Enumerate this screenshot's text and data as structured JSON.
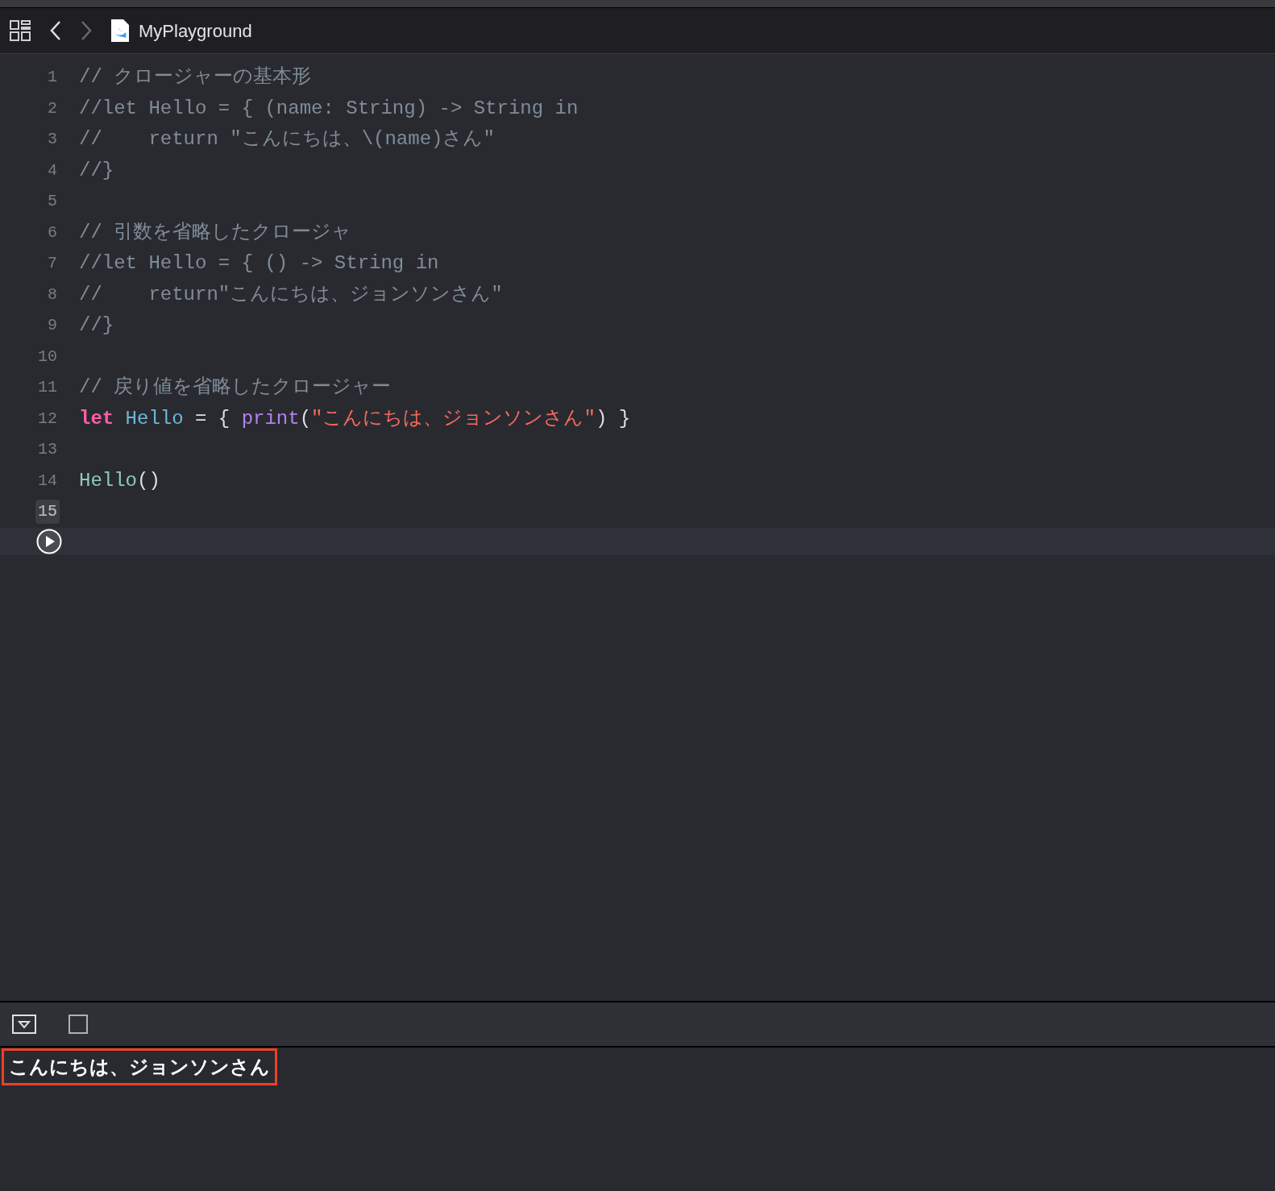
{
  "toolbar": {
    "title": "MyPlayground"
  },
  "editor": {
    "lines": [
      {
        "number": "1",
        "current": false,
        "tokens": [
          {
            "kind": "comment",
            "text": "// クロージャーの基本形"
          }
        ]
      },
      {
        "number": "2",
        "current": false,
        "tokens": [
          {
            "kind": "comment",
            "text": "//let Hello = { (name: String) -> String in"
          }
        ]
      },
      {
        "number": "3",
        "current": false,
        "tokens": [
          {
            "kind": "comment",
            "text": "//    return \"こんにちは、\\(name)さん\""
          }
        ]
      },
      {
        "number": "4",
        "current": false,
        "tokens": [
          {
            "kind": "comment",
            "text": "//}"
          }
        ]
      },
      {
        "number": "5",
        "current": false
      },
      {
        "number": "6",
        "current": false,
        "tokens": [
          {
            "kind": "comment",
            "text": "// 引数を省略したクロージャ"
          }
        ]
      },
      {
        "number": "7",
        "current": false,
        "tokens": [
          {
            "kind": "comment",
            "text": "//let Hello = { () -> String in"
          }
        ]
      },
      {
        "number": "8",
        "current": false,
        "tokens": [
          {
            "kind": "comment",
            "text": "//    return\"こんにちは、ジョンソンさん\""
          }
        ]
      },
      {
        "number": "9",
        "current": false,
        "tokens": [
          {
            "kind": "comment",
            "text": "//}"
          }
        ]
      },
      {
        "number": "10",
        "current": false
      },
      {
        "number": "11",
        "current": false,
        "tokens": [
          {
            "kind": "comment",
            "text": "// 戻り値を省略したクロージャー"
          }
        ]
      },
      {
        "number": "12",
        "current": false,
        "tokens": [
          {
            "kind": "keyword",
            "text": "let "
          },
          {
            "kind": "declaration",
            "text": "Hello"
          },
          {
            "kind": "plain",
            "text": " = { "
          },
          {
            "kind": "function",
            "text": "print"
          },
          {
            "kind": "plain",
            "text": "("
          },
          {
            "kind": "string",
            "text": "\"こんにちは、ジョンソンさん\""
          },
          {
            "kind": "plain",
            "text": ") }"
          }
        ]
      },
      {
        "number": "13",
        "current": false
      },
      {
        "number": "14",
        "current": false,
        "tokens": [
          {
            "kind": "call",
            "text": "Hello"
          },
          {
            "kind": "plain",
            "text": "()"
          }
        ]
      },
      {
        "number": "15",
        "current": true
      }
    ]
  },
  "console": {
    "output": "こんにちは、ジョンソンさん",
    "highlighted": true
  }
}
